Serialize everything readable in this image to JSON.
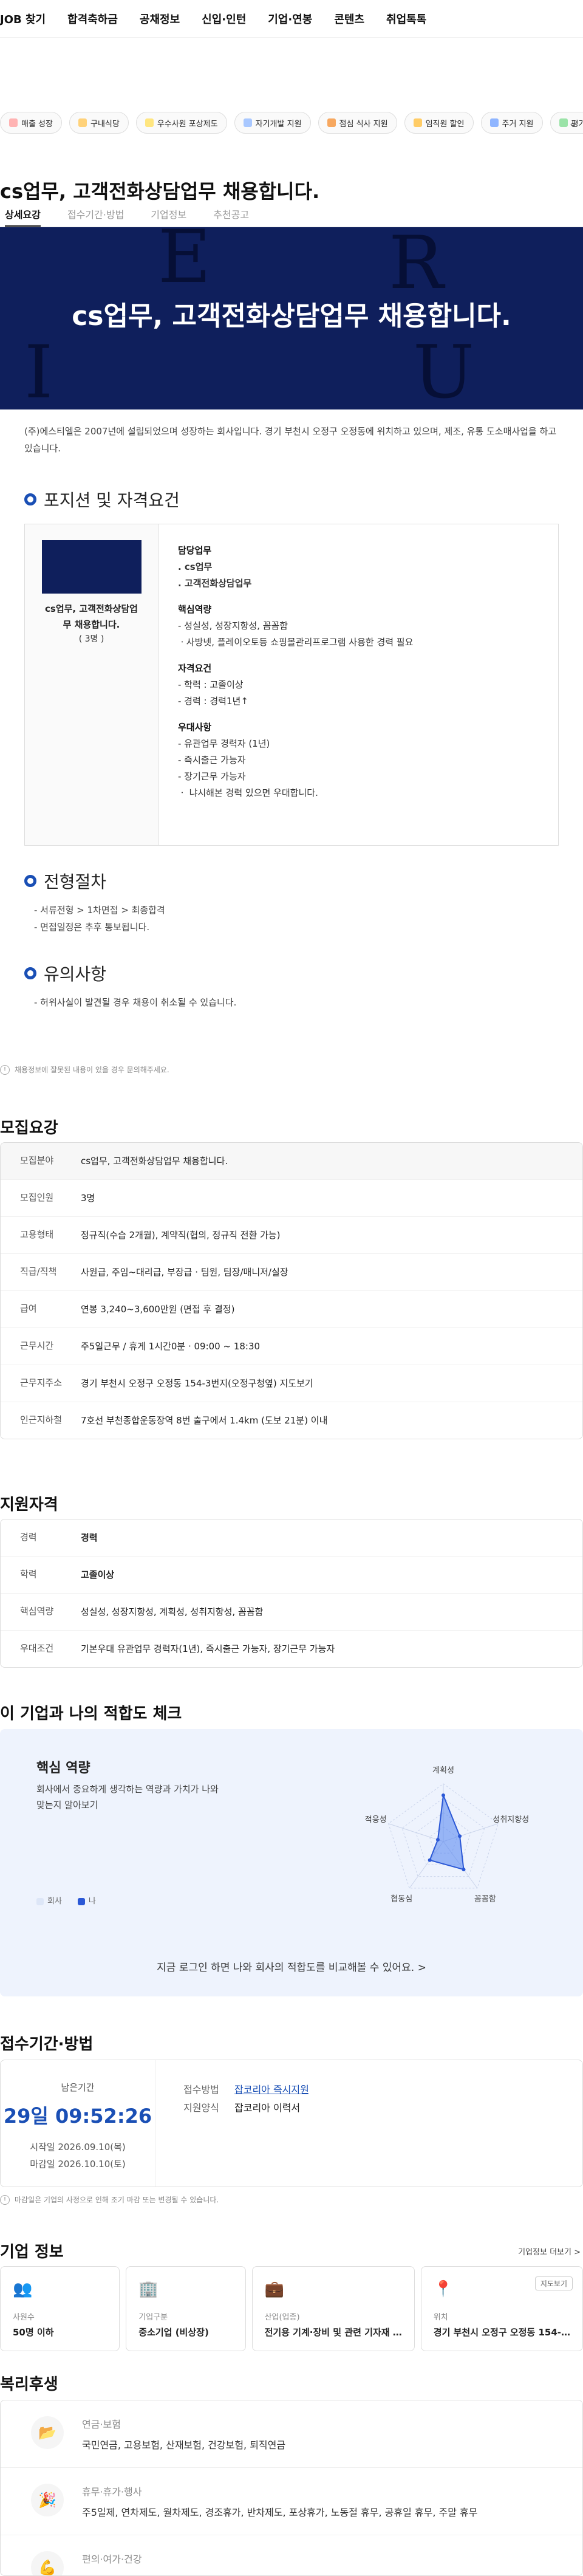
{
  "nav": [
    "JOB 찾기",
    "합격축하금",
    "공채정보",
    "신입·인턴",
    "기업·연봉",
    "콘텐츠",
    "취업톡톡"
  ],
  "benefit_chips": [
    {
      "label": "매출 성장",
      "color": "#ffb3b3"
    },
    {
      "label": "구내식당",
      "color": "#ffd27a"
    },
    {
      "label": "우수사원 포상제도",
      "color": "#ffe680"
    },
    {
      "label": "자기개발 지원",
      "color": "#a9c8ff"
    },
    {
      "label": "점심 식사 지원",
      "color": "#f7a860"
    },
    {
      "label": "임직원 할인",
      "color": "#ffcc66"
    },
    {
      "label": "주거 지원",
      "color": "#8fb5ff"
    },
    {
      "label": "평가",
      "color": "#9be3a8"
    }
  ],
  "job_title": "cs업무, 고객전화상담업무 채용합니다.",
  "tabs": [
    "상세요강",
    "접수기간·방법",
    "기업정보",
    "추천공고"
  ],
  "banner": {
    "title": "cs업무, 고객전화상담업무 채용합니다.",
    "bg_letters": [
      "E",
      "R",
      "I",
      "U"
    ]
  },
  "intro": "(주)에스티엘은 2007년에 설립되었으며 성장하는 회사입니다. 경기 부천시 오정구 오정동에 위치하고 있으며, 제조, 유통 도소매사업을 하고 있습니다.",
  "position": {
    "heading": "포지션 및 자격요건",
    "card_title": "cs업무, 고객전화상담업무 채용합니다.",
    "card_count": "( 3명 )",
    "duty_h": "담당업무",
    "duties": [
      ". cs업무",
      ". 고객전화상담업무"
    ],
    "core_h": "핵심역량",
    "core": [
      "- 성실성, 성장지향성, 꼼꼼함",
      "ㆍ사방넷, 플레이오토등 쇼핑몰관리프로그램 사용한 경력 필요"
    ],
    "qual_h": "자격요건",
    "quals": [
      "- 학력 : 고졸이상",
      "- 경력 : 경력1년↑"
    ],
    "pref_h": "우대사항",
    "prefs": [
      "- 유관업무 경력자 (1년)",
      "- 즉시출근 가능자",
      "- 장기근무 가능자",
      "ㆍ 냐시해본 경력 있으면 우대합니다."
    ]
  },
  "process": {
    "heading": "전형절차",
    "lines": [
      "- 서류전형 > 1차면접 > 최종합격",
      "- 면접일정은 추후 통보됩니다."
    ]
  },
  "caution": {
    "heading": "유의사항",
    "lines": [
      "- 허위사실이 발견될 경우 채용이 취소될 수 있습니다."
    ]
  },
  "notice1": "채용정보에 잘못된 내용이 있을 경우 문의해주세요.",
  "summary": {
    "heading": "모집요강",
    "rows": [
      {
        "k": "모집분야",
        "v": "cs업무, 고객전화상담업무 채용합니다."
      },
      {
        "k": "모집인원",
        "v": "3명"
      },
      {
        "k": "고용형태",
        "v": "정규직(수습 2개월), 계약직(협의, 정규직 전환 가능)"
      },
      {
        "k": "직급/직책",
        "v": "사원급, 주임~대리급, 부장급 · 팀원, 팀장/매니저/실장"
      },
      {
        "k": "급여",
        "v": "연봉 3,240~3,600만원 (면접 후 결정)"
      },
      {
        "k": "근무시간",
        "v": "주5일근무 / 휴게 1시간0분 · 09:00 ~ 18:30"
      },
      {
        "k": "근무지주소",
        "v": "경기 부천시 오정구 오정동 154-3번지(오정구청옆)  지도보기"
      },
      {
        "k": "인근지하철",
        "v": "7호선  부천종합운동장역 8번 출구에서 1.4km (도보 21분) 이내"
      }
    ]
  },
  "qualify": {
    "heading": "지원자격",
    "rows": [
      {
        "k": "경력",
        "v": "경력"
      },
      {
        "k": "학력",
        "v": "고졸이상"
      },
      {
        "k": "핵심역량",
        "v": "성실성, 성장지향성, 계획성, 성취지향성, 꼼꼼함"
      },
      {
        "k": "우대조건",
        "v": "기본우대   유관업무 경력자(1년), 즉시출근 가능자, 장기근무 가능자"
      }
    ]
  },
  "fit": {
    "heading": "이 기업과 나의 적합도 체크",
    "card_title": "핵심 역량",
    "desc": "회사에서 중요하게 생각하는 역량과 가치가 나와 맞는지 알아보기",
    "axes": [
      "계획성",
      "성취지향성",
      "꼼꼼함",
      "협동심",
      "적응성"
    ],
    "company_values": [
      0.8,
      0.3,
      0.6,
      0.4,
      0.1
    ],
    "legend_company": "회사",
    "legend_me": "나",
    "login_text": "지금 로그인 하면 나와 회사의 적합도를 비교해볼 수 있어요. >"
  },
  "apply": {
    "heading": "접수기간·방법",
    "remain_label": "남은기간",
    "remain": "29일 09:52:26",
    "start": "시작일   2026.09.10(목)",
    "end": "마감일   2026.10.10(토)",
    "method_k": "접수방법",
    "method_v": "잡코리아 즉시지원",
    "form_k": "지원양식",
    "form_v": "잡코리아 이력서",
    "note": "마감일은 기업의 사정으로 인해 조기 마감 또는 변경될 수 있습니다."
  },
  "company": {
    "heading": "기업 정보",
    "more": "기업정보 더보기 >",
    "cards": [
      {
        "icon": "👥",
        "lbl": "사원수",
        "val": "50명 이하"
      },
      {
        "icon": "🏢",
        "lbl": "기업구분",
        "val": "중소기업 (비상장)"
      },
      {
        "icon": "💼",
        "lbl": "산업(업종)",
        "val": "전기용 기계·장비 및 관련 기자재 …"
      },
      {
        "icon": "📍",
        "lbl": "위치",
        "val": "경기 부천시 오정구 오정동 154-…",
        "map": "지도보기"
      }
    ]
  },
  "welfare": {
    "heading": "복리후생",
    "items": [
      {
        "icon": "📂",
        "t": "연금·보험",
        "v": "국민연금, 고용보험, 산재보험, 건강보험, 퇴직연금"
      },
      {
        "icon": "🎉",
        "t": "휴무·휴가·행사",
        "v": "주5일제, 연차제도, 월차제도, 경조휴가, 반차제도, 포상휴가, 노동절 휴무, 공휴일 휴무, 주말 휴무"
      },
      {
        "icon": "💪",
        "t": "편의·여가·건강",
        "v": ""
      }
    ]
  }
}
